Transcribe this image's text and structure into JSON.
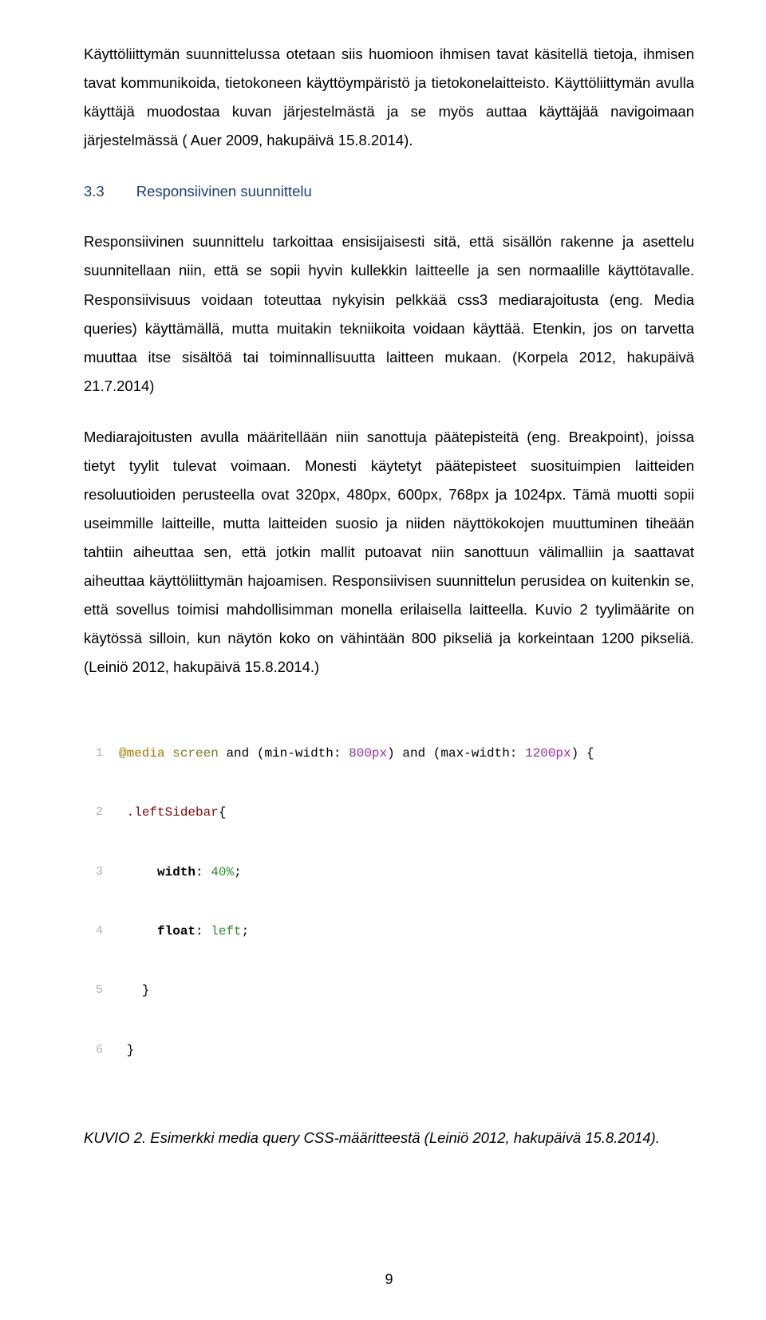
{
  "paragraphs": {
    "p1": "Käyttöliittymän suunnittelussa otetaan siis huomioon ihmisen tavat käsitellä tietoja, ihmisen tavat kommunikoida, tietokoneen käyttöympäristö ja tietokonelaitteisto. Käyttöliittymän avulla käyttäjä muodostaa kuvan järjestelmästä ja se myös auttaa käyttäjää navigoimaan järjestelmässä ( Auer 2009, hakupäivä 15.8.2014).",
    "h_num": "3.3",
    "h_text": "Responsiivinen suunnittelu",
    "p2": "Responsiivinen suunnittelu tarkoittaa ensisijaisesti sitä, että sisällön rakenne ja asettelu suunnitellaan niin, että se sopii hyvin kullekkin laitteelle ja sen normaalille käyttötavalle. Responsiivisuus voidaan toteuttaa nykyisin pelkkää css3 mediarajoitusta (eng. Media queries) käyttämällä, mutta muitakin tekniikoita voidaan käyttää. Etenkin, jos on tarvetta muuttaa itse sisältöä tai toiminnallisuutta laitteen mukaan. (Korpela 2012, hakupäivä 21.7.2014)",
    "p3": "Mediarajoitusten avulla määritellään niin sanottuja päätepisteitä (eng. Breakpoint), joissa tietyt tyylit tulevat voimaan. Monesti käytetyt päätepisteet suosituimpien laitteiden resoluutioiden perusteella ovat 320px, 480px, 600px, 768px ja 1024px. Tämä muotti sopii useimmille laitteille, mutta laitteiden suosio ja niiden näyttökokojen muuttuminen tiheään tahtiin aiheuttaa sen, että jotkin mallit putoavat niin sanottuun välimalliin ja saattavat aiheuttaa käyttöliittymän hajoamisen. Responsiivisen suunnittelun perusidea on kuitenkin se, että sovellus toimisi mahdollisimman monella erilaisella laitteella. Kuvio 2 tyylimäärite on käytössä silloin, kun näytön koko on vähintään 800 pikseliä ja korkeintaan 1200 pikseliä. (Leiniö 2012, hakupäivä 15.8.2014.)"
  },
  "code": {
    "l1_media": "@media",
    "l1_screen": "screen",
    "l1_and1": "and",
    "l1_minw": "min-width",
    "l1_minv": "800px",
    "l1_and2": "and",
    "l1_maxw": "max-width",
    "l1_maxv": "1200px",
    "l2_sel": ".leftSidebar",
    "l3_prop": "width",
    "l3_val": "40%",
    "l4_prop": "float",
    "l4_val": "left"
  },
  "caption": "KUVIO 2. Esimerkki media query CSS-määritteestä (Leiniö 2012, hakupäivä 15.8.2014).",
  "pagenum": "9"
}
